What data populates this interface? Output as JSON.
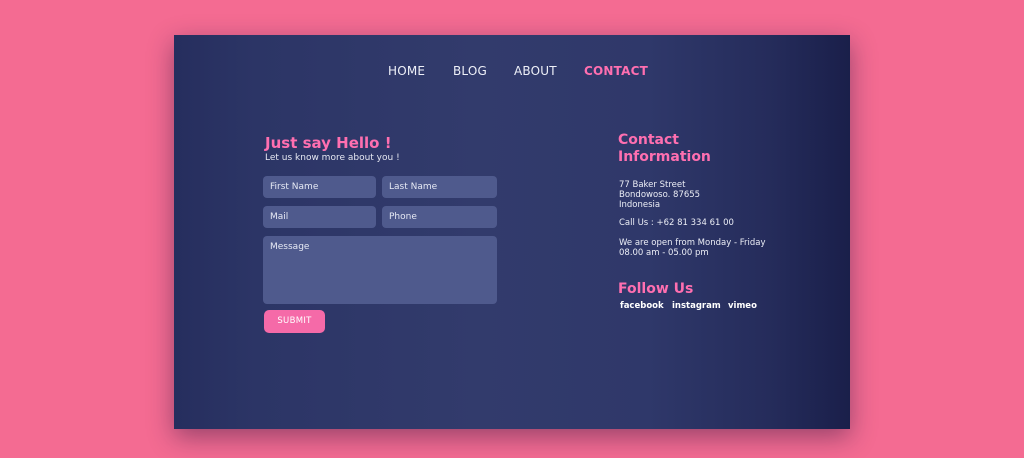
{
  "nav": {
    "items": [
      {
        "label": "HOME",
        "active": false
      },
      {
        "label": "BLOG",
        "active": false
      },
      {
        "label": "ABOUT",
        "active": false
      },
      {
        "label": "CONTACT",
        "active": true
      }
    ]
  },
  "form": {
    "title": "Just say Hello !",
    "subtitle": "Let us know more about you !",
    "first_name_placeholder": "First Name",
    "last_name_placeholder": "Last Name",
    "mail_placeholder": "Mail",
    "phone_placeholder": "Phone",
    "message_placeholder": "Message",
    "submit_label": "SUBMIT"
  },
  "contact": {
    "heading_line1": "Contact",
    "heading_line2": "Information",
    "address_line1": "77  Baker Street",
    "address_line2": "Bondowoso. 87655",
    "address_line3": "Indonesia",
    "phone": "Call Us : +62 81 334 61 00",
    "hours_line1": "We are open from Monday - Friday",
    "hours_line2": "08.00 am - 05.00 pm"
  },
  "follow": {
    "heading": "Follow Us",
    "links": [
      "facebook",
      "instagram",
      "vimeo"
    ]
  },
  "colors": {
    "background": "#f46b92",
    "card": "#2f386a",
    "accent": "#ff6fb0",
    "field": "#4f5a8d",
    "button": "#f56aa8"
  }
}
